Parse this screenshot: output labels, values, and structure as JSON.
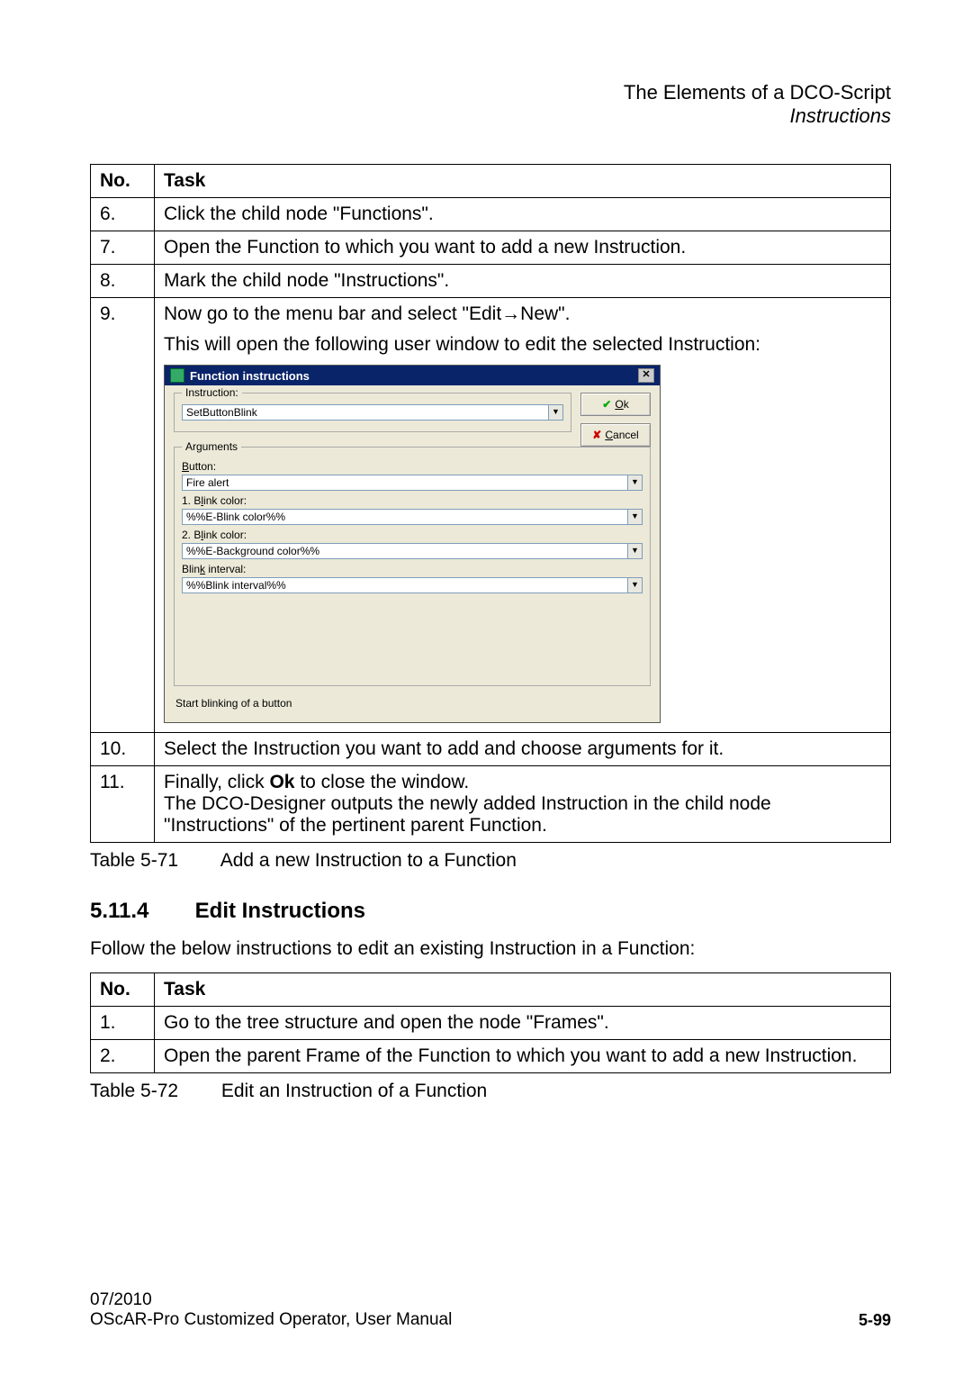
{
  "header": {
    "line1": "The Elements of a DCO-Script",
    "line2": "Instructions"
  },
  "table1": {
    "head_no": "No.",
    "head_task": "Task",
    "rows": {
      "r6_no": "6.",
      "r6_task": "Click the child node \"Functions\".",
      "r7_no": "7.",
      "r7_task": "Open the Function to which you want to add a new Instruction.",
      "r8_no": "8.",
      "r8_task": "Mark the child node \"Instructions\".",
      "r9_no": "9.",
      "r9_line1a": "Now go to the menu bar and select \"Edit",
      "r9_arrow": "→",
      "r9_line1b": "New\".",
      "r9_line2": "This will open the following user window to edit the selected Instruction:",
      "r10_no": "10.",
      "r10_task": "Select the Instruction you want to add and choose arguments for it.",
      "r11_no": "11.",
      "r11_l1a": "Finally, click ",
      "r11_l1b": "Ok",
      "r11_l1c": " to close the window.",
      "r11_l2": "The DCO-Designer outputs the newly added Instruction in the child node \"Instructions\" of the pertinent parent Function."
    }
  },
  "dialog": {
    "title": "Function instructions",
    "close": "✕",
    "grp1_legend_pre": "I",
    "grp1_legend_post": "nstruction:",
    "instruction_value": "SetButtonBlink",
    "ok_pre": "O",
    "ok_post": "k",
    "cancel_pre": "C",
    "cancel_post": "ancel",
    "grp2_legend": "Arguments",
    "lbl_button_pre": "B",
    "lbl_button_post": "utton:",
    "val_button": "Fire alert",
    "lbl_bc1_pre": "1. B",
    "lbl_bc1_u": "l",
    "lbl_bc1_post": "ink color:",
    "val_bc1": "%%E-Blink color%%",
    "lbl_bc2_pre": "2. B",
    "lbl_bc2_u": "l",
    "lbl_bc2_post": "ink color:",
    "val_bc2": "%%E-Background color%%",
    "lbl_int_pre": "Blin",
    "lbl_int_u": "k",
    "lbl_int_post": " interval:",
    "val_int": "%%Blink interval%%",
    "status": "Start blinking of a button"
  },
  "caption1": {
    "no": "Table 5-71",
    "text": "Add a new Instruction to a Function"
  },
  "section": {
    "num": "5.11.4",
    "title": "Edit Instructions"
  },
  "intro": "Follow the below instructions to edit an existing Instruction in a Function:",
  "table2": {
    "head_no": "No.",
    "head_task": "Task",
    "r1_no": "1.",
    "r1_task": "Go to the tree structure and open the node \"Frames\".",
    "r2_no": "2.",
    "r2_task": "Open the parent Frame of the Function to which you want to add a new Instruction."
  },
  "caption2": {
    "no": "Table 5-72",
    "text": "Edit an Instruction of a Function"
  },
  "footer": {
    "date": "07/2010",
    "doc": "OScAR-Pro Customized Operator, User Manual",
    "page": "5-99"
  }
}
